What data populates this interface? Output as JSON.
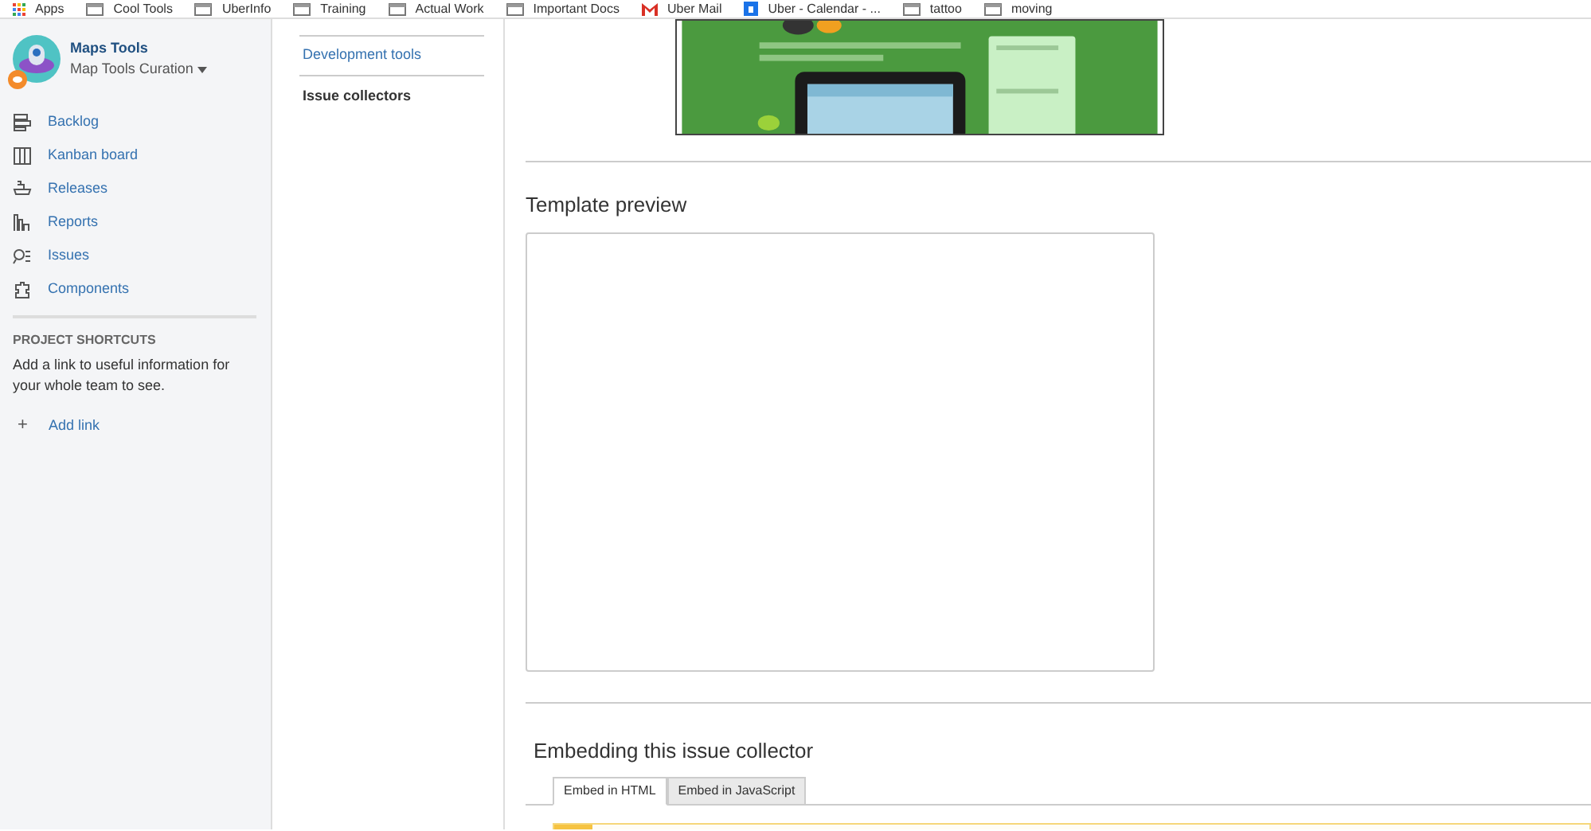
{
  "bookmarks_bar": {
    "items": [
      {
        "label": "Apps",
        "kind": "apps"
      },
      {
        "label": "Cool Tools",
        "kind": "folder"
      },
      {
        "label": "UberInfo",
        "kind": "folder"
      },
      {
        "label": "Training",
        "kind": "folder"
      },
      {
        "label": "Actual Work",
        "kind": "folder"
      },
      {
        "label": "Important Docs",
        "kind": "folder"
      },
      {
        "label": "Uber Mail",
        "kind": "mail"
      },
      {
        "label": "Uber - Calendar - ...",
        "kind": "calendar"
      },
      {
        "label": "tattoo",
        "kind": "folder"
      },
      {
        "label": "moving",
        "kind": "folder"
      }
    ]
  },
  "sidebar": {
    "project": {
      "name": "Maps Tools",
      "board": "Map Tools Curation"
    },
    "items": [
      {
        "label": "Backlog",
        "kind": "backlog"
      },
      {
        "label": "Kanban board",
        "kind": "kanban"
      },
      {
        "label": "Releases",
        "kind": "releases"
      },
      {
        "label": "Reports",
        "kind": "reports"
      },
      {
        "label": "Issues",
        "kind": "issues"
      },
      {
        "label": "Components",
        "kind": "components"
      }
    ],
    "shortcuts": {
      "heading": "PROJECT SHORTCUTS",
      "text": "Add a link to useful information for your whole team to see.",
      "add_link": "+",
      "add_label": "Add link"
    }
  },
  "settings_nav": {
    "items": [
      {
        "label": "Development tools",
        "selected": false
      },
      {
        "label": "Issue collectors",
        "selected": true
      }
    ]
  },
  "main": {
    "preview_heading": "Template preview",
    "embed_heading": "Embedding this issue collector",
    "tabs": [
      {
        "label": "Embed in HTML",
        "selected": true
      },
      {
        "label": "Embed in JavaScript",
        "selected": false
      }
    ]
  }
}
